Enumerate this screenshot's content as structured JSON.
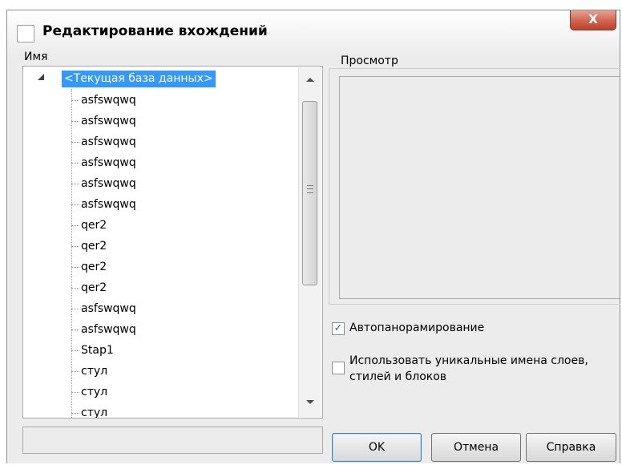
{
  "window": {
    "title": "Редактирование вхождений",
    "close_glyph": "X"
  },
  "left_panel": {
    "label": "Имя",
    "tree": {
      "root": "<Текущая база данных>",
      "items": [
        "asfswqwq",
        "asfswqwq",
        "asfswqwq",
        "asfswqwq",
        "asfswqwq",
        "asfswqwq",
        "qer2",
        "qer2",
        "qer2",
        "qer2",
        "asfswqwq",
        "asfswqwq",
        "Stap1",
        "стул",
        "стул",
        "стул"
      ]
    },
    "status_value": ""
  },
  "preview": {
    "label": "Просмотр"
  },
  "options": {
    "autopan": {
      "label": "Автопанорамирование",
      "checked": true,
      "check_glyph": "✓"
    },
    "unique_names": {
      "label_line1": "Использовать уникальные имена слоев,",
      "label_line2": "стилей и блоков",
      "checked": false
    }
  },
  "buttons": {
    "ok": "OK",
    "cancel": "Отмена",
    "help": "Справка"
  },
  "colors": {
    "selection": "#3399ff",
    "close_button": "#c9523f",
    "checkmark": "#2a62c9"
  }
}
